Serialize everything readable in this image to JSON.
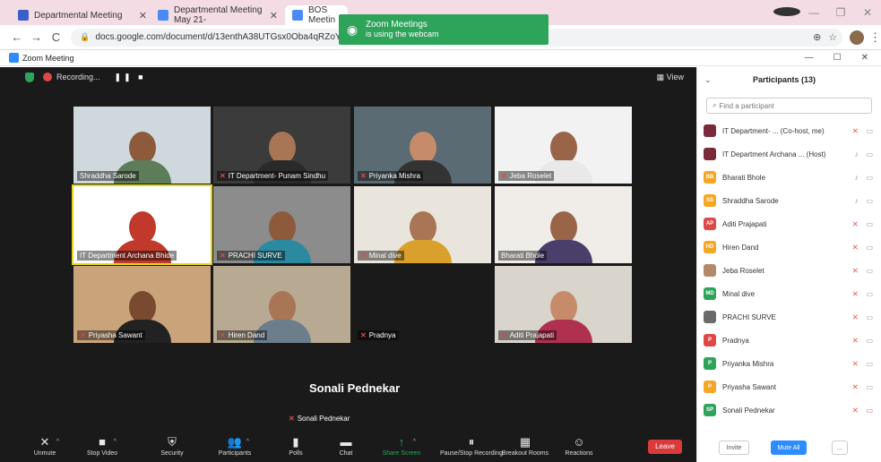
{
  "browser": {
    "tabs": [
      {
        "title": "Departmental Meeting",
        "color": "#3b5fc9"
      },
      {
        "title": "Departmental Meeting May 21-",
        "color": "#4a8af4"
      },
      {
        "title": "BOS Meetin",
        "color": "#4a8af4"
      }
    ],
    "url": "docs.google.com/document/d/13enthA38UTGsx0Oba4qRZoYKvDAtldT"
  },
  "toast": {
    "title": "Zoom Meetings",
    "subtitle": "is using the webcam"
  },
  "zoom": {
    "window_title": "Zoom Meeting",
    "recording_label": "Recording...",
    "view_label": "View",
    "active_speaker": "Sonali Pednekar",
    "tiles": [
      {
        "name": "Shraddha Sarode",
        "muted": false,
        "bg": "#cfd8dc",
        "skin": "#8d5a3c",
        "cloth": "#5d7c5a"
      },
      {
        "name": "IT Department- Punam Sindhu",
        "muted": true,
        "bg": "#3b3b3b",
        "skin": "#a87555",
        "cloth": "#2a2a2a"
      },
      {
        "name": "Priyanka Mishra",
        "muted": true,
        "bg": "#5a6b73",
        "skin": "#c68b6a",
        "cloth": "#333"
      },
      {
        "name": "Jeba Roselet",
        "muted": true,
        "bg": "#f2f2f2",
        "skin": "#9a6448",
        "cloth": "#e9e9e9"
      },
      {
        "name": "IT Department Archana Bhide",
        "muted": false,
        "bg": "#ffffff",
        "skin": "#c0392b",
        "cloth": "#c0392b"
      },
      {
        "name": "PRACHI SURVE",
        "muted": true,
        "bg": "#8c8c8c",
        "skin": "#8d5a3c",
        "cloth": "#2b8aa0"
      },
      {
        "name": "Minal dive",
        "muted": true,
        "bg": "#e9e4dc",
        "skin": "#a87555",
        "cloth": "#d9a12b"
      },
      {
        "name": "Bharati Bhole",
        "muted": false,
        "bg": "#f0ede8",
        "skin": "#9a6448",
        "cloth": "#4a3f6b"
      },
      {
        "name": "Priyasha Sawant",
        "muted": true,
        "bg": "#c9a37a",
        "skin": "#7a4a30",
        "cloth": "#222"
      },
      {
        "name": "Hiren Dand",
        "muted": true,
        "bg": "#b8aa92",
        "skin": "#a87555",
        "cloth": "#6c7d8c"
      },
      {
        "name": "Pradnya",
        "muted": true,
        "bg": "#1a1a1a",
        "skin": "#1a1a1a",
        "cloth": "#1a1a1a"
      },
      {
        "name": "Aditi Prajapati",
        "muted": true,
        "bg": "#d9d4cc",
        "skin": "#c68b6a",
        "cloth": "#b03050"
      }
    ],
    "toolbar": [
      {
        "label": "Unmute",
        "icon": "✕",
        "chev": true,
        "green": false
      },
      {
        "label": "Stop Video",
        "icon": "■",
        "chev": true,
        "green": false
      },
      {
        "label": "Security",
        "icon": "⛨",
        "chev": false,
        "green": false
      },
      {
        "label": "Participants",
        "icon": "👥",
        "chev": true,
        "green": false
      },
      {
        "label": "Polls",
        "icon": "▮",
        "chev": false,
        "green": false
      },
      {
        "label": "Chat",
        "icon": "▬",
        "chev": false,
        "green": false
      },
      {
        "label": "Share Screen",
        "icon": "↑",
        "chev": true,
        "green": true
      },
      {
        "label": "Pause/Stop Recording",
        "icon": "⏸",
        "chev": false,
        "green": false
      },
      {
        "label": "Breakout Rooms",
        "icon": "▦",
        "chev": false,
        "green": false
      },
      {
        "label": "Reactions",
        "icon": "☺",
        "chev": false,
        "green": false
      }
    ],
    "leave_label": "Leave"
  },
  "participants": {
    "title": "Participants (13)",
    "search_placeholder": "Find a participant",
    "list": [
      {
        "initials": "",
        "name": "IT Department- ... (Co-host, me)",
        "color": "#7a2b3b",
        "mic": "muted"
      },
      {
        "initials": "",
        "name": "IT Department Archana ... (Host)",
        "color": "#7a2b3b",
        "mic": "on"
      },
      {
        "initials": "BB",
        "name": "Bharati Bhole",
        "color": "#f5a623",
        "mic": "on"
      },
      {
        "initials": "SS",
        "name": "Shraddha Sarode",
        "color": "#f5a623",
        "mic": "on"
      },
      {
        "initials": "AP",
        "name": "Aditi Prajapati",
        "color": "#e04848",
        "mic": "muted"
      },
      {
        "initials": "HD",
        "name": "Hiren Dand",
        "color": "#f5a623",
        "mic": "muted"
      },
      {
        "initials": "",
        "name": "Jeba Roselet",
        "color": "#b08a6a",
        "mic": "muted"
      },
      {
        "initials": "MD",
        "name": "Minal dive",
        "color": "#2ea35a",
        "mic": "muted"
      },
      {
        "initials": "",
        "name": "PRACHI SURVE",
        "color": "#6a6a6a",
        "mic": "muted"
      },
      {
        "initials": "P",
        "name": "Pradnya",
        "color": "#e04848",
        "mic": "muted"
      },
      {
        "initials": "P",
        "name": "Priyanka Mishra",
        "color": "#2ea35a",
        "mic": "muted"
      },
      {
        "initials": "P",
        "name": "Priyasha Sawant",
        "color": "#f5a623",
        "mic": "muted"
      },
      {
        "initials": "SP",
        "name": "Sonali Pednekar",
        "color": "#2ea35a",
        "mic": "muted"
      }
    ],
    "invite_label": "Invite",
    "mute_all_label": "Mute All"
  }
}
